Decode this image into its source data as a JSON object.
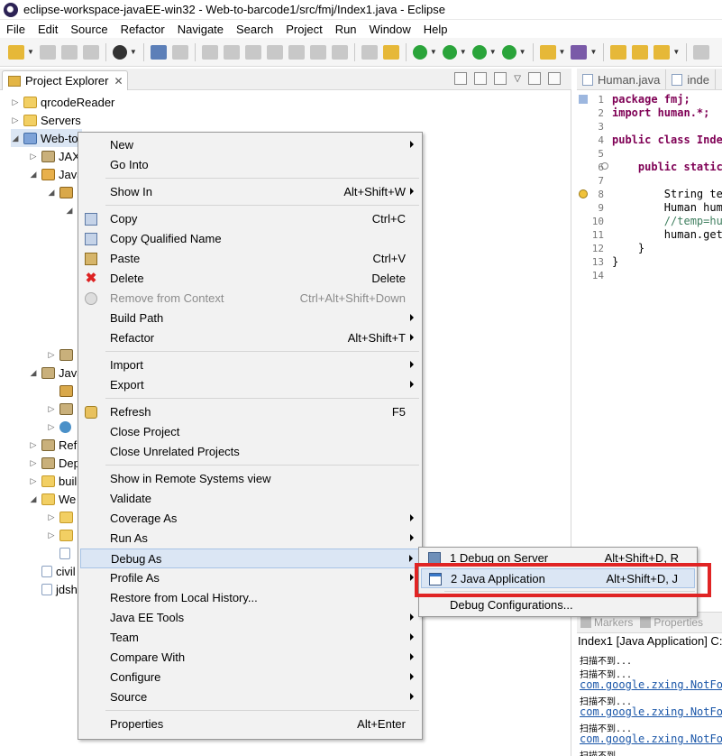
{
  "window": {
    "title": "eclipse-workspace-javaEE-win32 - Web-to-barcode1/src/fmj/Index1.java - Eclipse"
  },
  "menubar": [
    "File",
    "Edit",
    "Source",
    "Refactor",
    "Navigate",
    "Search",
    "Project",
    "Run",
    "Window",
    "Help"
  ],
  "project_explorer": {
    "tab_label": "Project Explorer",
    "tree": [
      {
        "label": "qrcodeReader"
      },
      {
        "label": "Servers"
      },
      {
        "label": "Web-to"
      },
      {
        "label": "JAX"
      },
      {
        "label": "Java"
      },
      {
        "label": ""
      },
      {
        "label": ""
      },
      {
        "label": "Java"
      },
      {
        "label": "Ref"
      },
      {
        "label": "Dep"
      },
      {
        "label": "buil"
      },
      {
        "label": "We"
      },
      {
        "label": "civil"
      },
      {
        "label": "jdsh"
      }
    ]
  },
  "editor": {
    "tabs": [
      "Human.java",
      "inde"
    ],
    "lines": [
      {
        "n": "1",
        "text": "package fmj;"
      },
      {
        "n": "2",
        "text": "import human.*;"
      },
      {
        "n": "3",
        "text": ""
      },
      {
        "n": "4",
        "text": "public class Index"
      },
      {
        "n": "5",
        "text": ""
      },
      {
        "n": "6",
        "text": "    public static"
      },
      {
        "n": "7",
        "text": ""
      },
      {
        "n": "8",
        "text": "        String tem"
      },
      {
        "n": "9",
        "text": "        Human huma"
      },
      {
        "n": "10",
        "text": "        //temp=hum"
      },
      {
        "n": "11",
        "text": "        human.gete"
      },
      {
        "n": "12",
        "text": "    }"
      },
      {
        "n": "13",
        "text": "}"
      },
      {
        "n": "14",
        "text": ""
      }
    ]
  },
  "console": {
    "tabs": [
      "Markers",
      "Properties"
    ],
    "title": "Index1 [Java Application] C:",
    "lines": [
      {
        "text": "扫描不到...",
        "link": false
      },
      {
        "text": "扫描不到...",
        "link": false
      },
      {
        "text": "com.google.zxing.NotFou",
        "link": true
      },
      {
        "text": "扫描不到...",
        "link": false
      },
      {
        "text": "com.google.zxing.NotFou",
        "link": true
      },
      {
        "text": "扫描不到...",
        "link": false
      },
      {
        "text": "com.google.zxing.NotFou",
        "link": true
      },
      {
        "text": "扫描不到...",
        "link": false
      }
    ]
  },
  "context_menu": {
    "items": {
      "new": {
        "label": "New"
      },
      "go_into": {
        "label": "Go Into"
      },
      "show_in": {
        "label": "Show In",
        "shortcut": "Alt+Shift+W"
      },
      "copy": {
        "label": "Copy",
        "shortcut": "Ctrl+C"
      },
      "copy_qualified": {
        "label": "Copy Qualified Name"
      },
      "paste": {
        "label": "Paste",
        "shortcut": "Ctrl+V"
      },
      "delete": {
        "label": "Delete",
        "shortcut": "Delete"
      },
      "remove_context": {
        "label": "Remove from Context",
        "shortcut": "Ctrl+Alt+Shift+Down"
      },
      "build_path": {
        "label": "Build Path"
      },
      "refactor": {
        "label": "Refactor",
        "shortcut": "Alt+Shift+T"
      },
      "import": {
        "label": "Import"
      },
      "export": {
        "label": "Export"
      },
      "refresh": {
        "label": "Refresh",
        "shortcut": "F5"
      },
      "close_project": {
        "label": "Close Project"
      },
      "close_unrelated": {
        "label": "Close Unrelated Projects"
      },
      "show_remote": {
        "label": "Show in Remote Systems view"
      },
      "validate": {
        "label": "Validate"
      },
      "coverage_as": {
        "label": "Coverage As"
      },
      "run_as": {
        "label": "Run As"
      },
      "debug_as": {
        "label": "Debug As"
      },
      "profile_as": {
        "label": "Profile As"
      },
      "restore_history": {
        "label": "Restore from Local History..."
      },
      "java_ee_tools": {
        "label": "Java EE Tools"
      },
      "team": {
        "label": "Team"
      },
      "compare_with": {
        "label": "Compare With"
      },
      "configure": {
        "label": "Configure"
      },
      "source": {
        "label": "Source"
      },
      "properties": {
        "label": "Properties",
        "shortcut": "Alt+Enter"
      }
    }
  },
  "debug_submenu": {
    "debug_on_server": {
      "label": "1 Debug on Server",
      "shortcut": "Alt+Shift+D, R"
    },
    "java_application": {
      "label": "2 Java Application",
      "shortcut": "Alt+Shift+D, J"
    },
    "debug_configurations": {
      "label": "Debug Configurations..."
    }
  },
  "colors": {
    "highlight": "#dbe6f4",
    "annotation_box": "#e02424",
    "keyword": "#7f0055",
    "comment": "#3f7f5f"
  }
}
